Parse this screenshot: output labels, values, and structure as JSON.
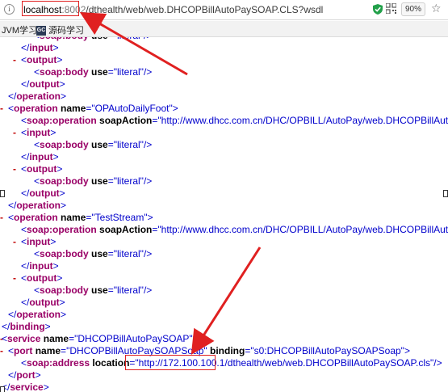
{
  "address_bar": {
    "url_host": "localhost",
    "url_port": ":8002",
    "url_path": "/dthealth/web/web.DHCOPBillAutoPaySOAP.CLS?wsdl",
    "zoom": "90%",
    "icons": [
      "info-icon",
      "shield-icon",
      "qr-code-icon",
      "star-icon"
    ]
  },
  "bookmarks": [
    {
      "label": "JVM学习"
    },
    {
      "badge": "GC",
      "label": "源码学习"
    }
  ],
  "xml_lines": [
    {
      "toggle": "",
      "text": "<soap:body use=\"literal\"/>"
    },
    {
      "toggle": "",
      "text": "</input>"
    },
    {
      "toggle": "-",
      "text": "<output>"
    },
    {
      "toggle": "",
      "text": "<soap:body use=\"literal\"/>"
    },
    {
      "toggle": "",
      "text": "</output>"
    },
    {
      "toggle": "",
      "text": "</operation>"
    },
    {
      "toggle": "-",
      "text": "<operation name=\"OPAutoDailyFoot\">"
    },
    {
      "toggle": "",
      "text": "<soap:operation soapAction=\"http://www.dhcc.com.cn/DHC/OPBILL/AutoPay/web.DHCOPBillAutoPaySOAP.OPAutoDailyFoot\""
    },
    {
      "toggle": "-",
      "text": "<input>"
    },
    {
      "toggle": "",
      "text": "<soap:body use=\"literal\"/>"
    },
    {
      "toggle": "",
      "text": "</input>"
    },
    {
      "toggle": "-",
      "text": "<output>"
    },
    {
      "toggle": "",
      "text": "<soap:body use=\"literal\"/>"
    },
    {
      "toggle": "",
      "text": "</output>"
    },
    {
      "toggle": "",
      "text": "</operation>"
    },
    {
      "toggle": "-",
      "text": "<operation name=\"TestStream\">"
    },
    {
      "toggle": "",
      "text": "<soap:operation soapAction=\"http://www.dhcc.com.cn/DHC/OPBILL/AutoPay/web.DHCOPBillAutoPaySOAP.TestStream\""
    },
    {
      "toggle": "-",
      "text": "<input>"
    },
    {
      "toggle": "",
      "text": "<soap:body use=\"literal\"/>"
    },
    {
      "toggle": "",
      "text": "</input>"
    },
    {
      "toggle": "-",
      "text": "<output>"
    },
    {
      "toggle": "",
      "text": "<soap:body use=\"literal\"/>"
    },
    {
      "toggle": "",
      "text": "</output>"
    },
    {
      "toggle": "",
      "text": "</operation>"
    },
    {
      "toggle": "",
      "text": "</binding>"
    },
    {
      "toggle": "-",
      "text": "<service name=\"DHCOPBillAutoPaySOAP\">"
    },
    {
      "toggle": "-",
      "text": "<port name=\"DHCOPBillAutoPaySOAPSoap\" binding=\"s0:DHCOPBillAutoPaySOAPSoap\">"
    },
    {
      "toggle": "",
      "text": "<soap:address location=\"http://172.100.100.1/dthealth/web/web.DHCOPBillAutoPaySOAP.cls\"/>"
    },
    {
      "toggle": "",
      "text": "</port>"
    },
    {
      "toggle": "",
      "text": "</service>"
    }
  ],
  "colors": {
    "tag": "#990066",
    "value": "#0000cc",
    "toggle": "#c00000",
    "annotation": "#e02020"
  }
}
